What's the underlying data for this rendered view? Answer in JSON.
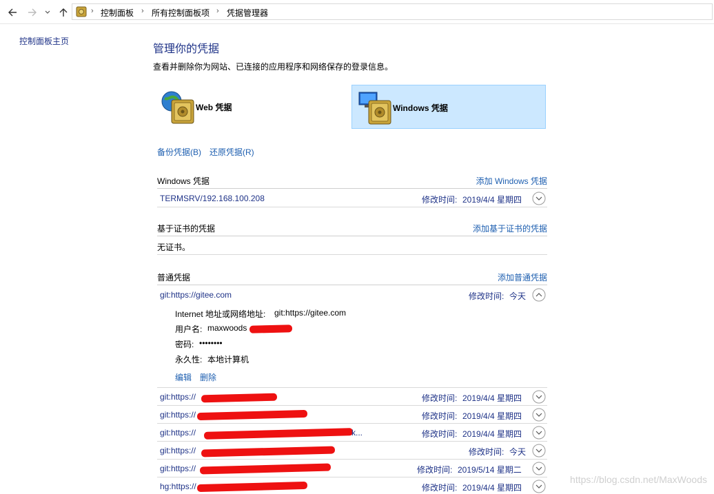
{
  "breadcrumb": {
    "items": [
      "控制面板",
      "所有控制面板项",
      "凭据管理器"
    ]
  },
  "left_nav": {
    "home": "控制面板主页"
  },
  "main": {
    "title": "管理你的凭据",
    "description": "查看并删除你为网站、已连接的应用程序和网络保存的登录信息。",
    "tiles": [
      {
        "label": "Web 凭据",
        "selected": false
      },
      {
        "label": "Windows 凭据",
        "selected": true
      }
    ],
    "backup": "备份凭据(B)",
    "restore": "还原凭据(R)"
  },
  "windows_section": {
    "title": "Windows 凭据",
    "add": "添加 Windows 凭据",
    "rows": [
      {
        "name": "TERMSRV/192.168.100.208",
        "mod_label": "修改时间:",
        "date": "2019/4/4 星期四"
      }
    ]
  },
  "cert_section": {
    "title": "基于证书的凭据",
    "add": "添加基于证书的凭据",
    "empty": "无证书。"
  },
  "generic_section": {
    "title": "普通凭据",
    "add": "添加普通凭据",
    "expanded": {
      "name": "git:https://gitee.com",
      "mod_label": "修改时间:",
      "date": "今天",
      "address_label": "Internet 地址或网络地址:",
      "address_value": "git:https://gitee.com",
      "user_label": "用户名:",
      "user_value": "maxwoods",
      "password_label": "密码:",
      "password_value": "••••••••",
      "persist_label": "永久性:",
      "persist_value": "本地计算机",
      "edit": "编辑",
      "delete": "删除"
    },
    "rows": [
      {
        "name": "git:https://",
        "mod_label": "修改时间:",
        "date": "2019/4/4 星期四"
      },
      {
        "name": "git:https://",
        "mod_label": "修改时间:",
        "date": "2019/4/4 星期四"
      },
      {
        "name": "git:https://",
        "suffix": "k...",
        "mod_label": "修改时间:",
        "date": "2019/4/4 星期四"
      },
      {
        "name": "git:https://",
        "mod_label": "修改时间:",
        "date": "今天"
      },
      {
        "name": "git:https://",
        "mod_label": "修改时间:",
        "date": "2019/5/14 星期二"
      },
      {
        "name": "hg:https://",
        "mod_label": "修改时间:",
        "date": "2019/4/4 星期四"
      }
    ]
  },
  "watermark": "https://blog.csdn.net/MaxWoods",
  "colors": {
    "link": "#1e5fb0",
    "heading": "#1e3287",
    "selected_bg": "#cce8ff",
    "redaction": "#ee1111"
  }
}
